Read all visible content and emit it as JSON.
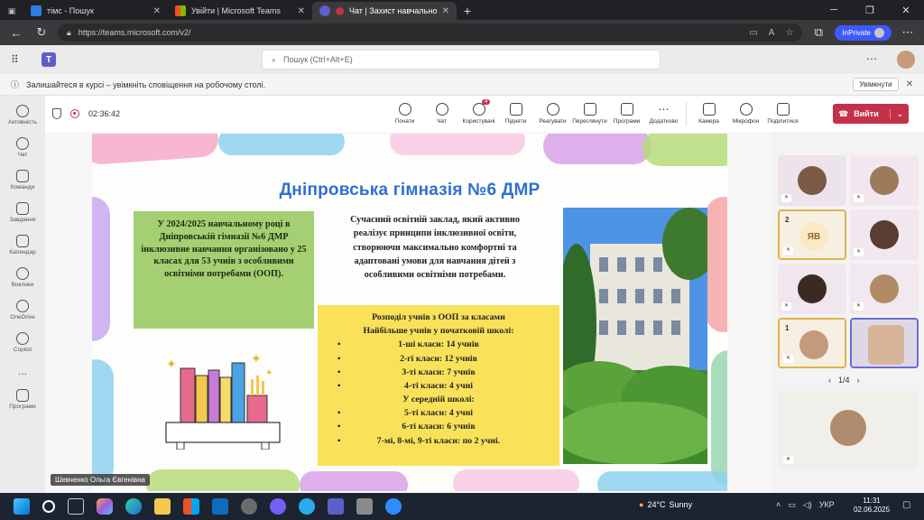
{
  "browser": {
    "tabs": [
      {
        "title": "тімс - Пошук"
      },
      {
        "title": "Увійти | Microsoft Teams"
      },
      {
        "title": "Чат | Захист навчальної пра..."
      }
    ],
    "url": "https://teams.microsoft.com/v2/",
    "inprivate_label": "InPrivate"
  },
  "teams": {
    "search_placeholder": "Пошук (Ctrl+Alt+E)",
    "notification": "Залишайтеся в курсі – увімкніть сповіщення на робочому столі.",
    "notification_button": "Увімкнути",
    "rail": [
      {
        "label": "Активність"
      },
      {
        "label": "Чат"
      },
      {
        "label": "Команди"
      },
      {
        "label": "Завдання"
      },
      {
        "label": "Календар"
      },
      {
        "label": "Виклики"
      },
      {
        "label": "OneDrive"
      },
      {
        "label": "Copilot"
      },
      {
        "label": "..."
      },
      {
        "label": "Програми"
      }
    ]
  },
  "meeting": {
    "timer": "02:36:42",
    "tools": [
      {
        "label": "Почати"
      },
      {
        "label": "Чат"
      },
      {
        "label": "Користувачі",
        "badge": "4"
      },
      {
        "label": "Підняти"
      },
      {
        "label": "Реагувати"
      },
      {
        "label": "Переглянути"
      },
      {
        "label": "Програми"
      },
      {
        "label": "Додатково"
      },
      {
        "label": "Камера"
      },
      {
        "label": "Мікрофон"
      },
      {
        "label": "Поділитися"
      }
    ],
    "leave_label": "Вийти",
    "speaker_name": "Шевченко Ольга Євгенівна",
    "participants": {
      "initials_tile": "ЯВ",
      "hand_1": "2",
      "hand_2": "1",
      "pager": "1/4"
    }
  },
  "slide": {
    "title": "Дніпровська гімназія №6 ДМР",
    "green_box": "У 2024/2025 навчальному році в Дніпровській гімназії №6 ДМР інклюзивне навчання організовано у 25 класах для 53 учнів з особливими освітніми потребами (ООП).",
    "intro": "Сучасний освітній заклад, який активно реалізує принципи інклюзивної освіти, створюючи максимально комфортні та адаптовані умови для навчання дітей з особливими освітніми потребами.",
    "distribution_title": "Розподіл учнів з ООП за класами",
    "primary_heading": "Найбільше учнів у початковій школі:",
    "primary": [
      "1-ші класи: 14 учнів",
      "2-гі класи: 12 учнів",
      "3-ті класи: 7 учнів",
      "4-ті класи: 4 учні"
    ],
    "middle_heading": "У середній школі:",
    "middle": [
      "5-ті класи: 4 учні",
      "6-ті класи: 6 учнів",
      "7-мі, 8-мі, 9-ті класи: по 2 учні."
    ]
  },
  "taskbar": {
    "weather_temp": "24°C",
    "weather_text": "Sunny",
    "lang": "УКР",
    "time": "11:31",
    "date": "02.06.2025"
  }
}
